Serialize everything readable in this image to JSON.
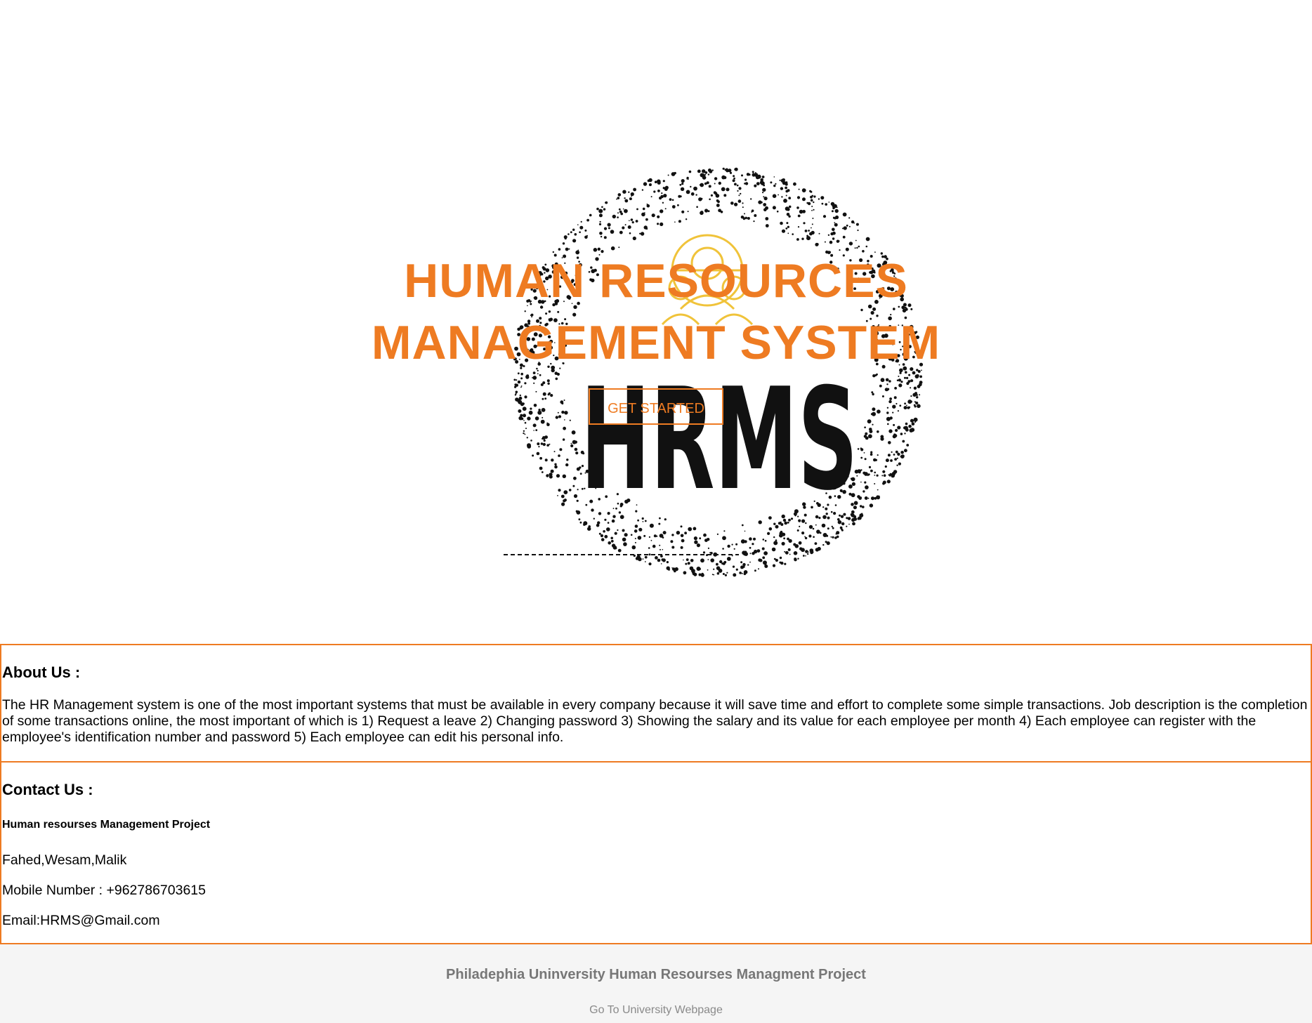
{
  "hero": {
    "title_line1": "HUMAN RESOURCES",
    "title_line2": "MANAGEMENT SYSTEM",
    "cta_label": "GET STARTED",
    "logo_text": "HRMS",
    "colors": {
      "accent": "#ee7b22",
      "logo_ink": "#111111",
      "logo_icon": "#f0c33a"
    }
  },
  "about": {
    "heading": "About Us :",
    "body": "The HR Management system is one of the most important systems that must be available in every company because it will save time and effort to complete some simple transactions. Job description is the completion of some transactions online, the most important of which is 1) Request a leave 2) Changing password 3) Showing the salary and its value for each employee per month 4) Each employee can register with the employee's identification number and password 5) Each employee can edit his personal info."
  },
  "contact": {
    "heading": "Contact Us :",
    "project": "Human resourses Management Project",
    "names": "Fahed,Wesam,Malik",
    "mobile": "Mobile Number : +962786703615",
    "email": "Email:HRMS@Gmail.com"
  },
  "footer": {
    "title": "Philadephia Uninversity Human Resourses Managment Project",
    "link_label": "Go To University Webpage"
  }
}
